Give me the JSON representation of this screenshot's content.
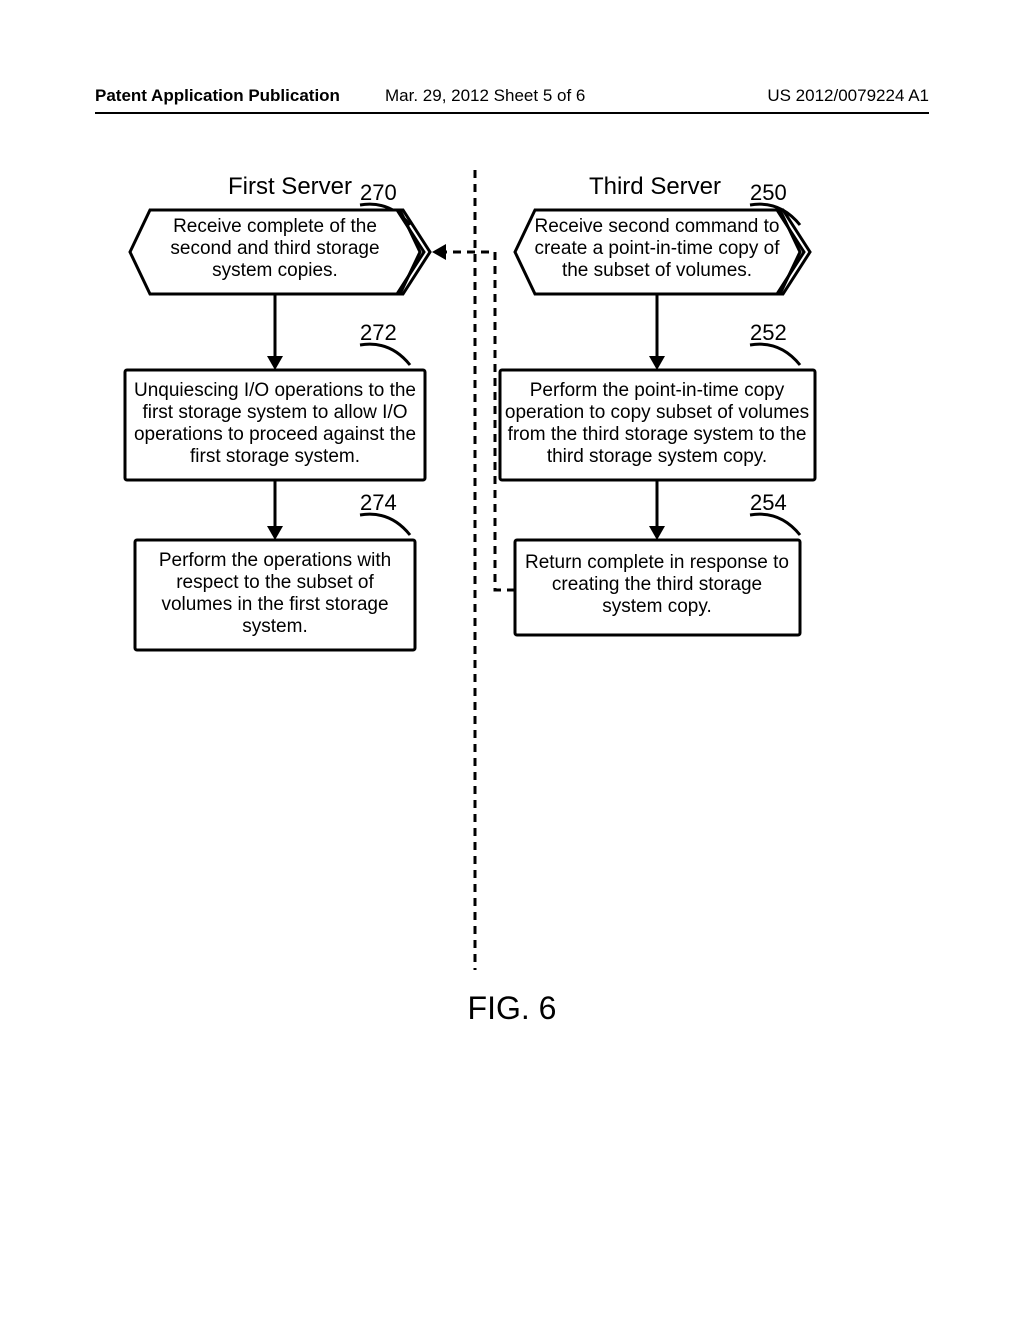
{
  "header": {
    "left": "Patent Application Publication",
    "mid": "Mar. 29, 2012  Sheet 5 of 6",
    "right": "US 2012/0079224 A1"
  },
  "titles": {
    "left": "First Server",
    "right": "Third Server"
  },
  "refs": {
    "r270": "270",
    "r272": "272",
    "r274": "274",
    "r250": "250",
    "r252": "252",
    "r254": "254"
  },
  "blocks": {
    "b270": [
      "Receive complete of the",
      "second and third storage",
      "system copies."
    ],
    "b272": [
      "Unquiescing I/O operations to the",
      "first storage system to allow I/O",
      "operations to proceed against the",
      "first storage system."
    ],
    "b274": [
      "Perform the operations with",
      "respect to the subset of",
      "volumes in the first storage",
      "system."
    ],
    "b250": [
      "Receive second command to",
      "create a point-in-time copy of",
      "the subset of volumes."
    ],
    "b252": [
      "Perform the point-in-time copy",
      "operation to copy subset of volumes",
      "from the third storage system to the",
      "third storage system copy."
    ],
    "b254": [
      "Return complete in response to",
      "creating the third storage",
      "system copy."
    ]
  },
  "figure_label": "FIG. 6",
  "chart_data": {
    "type": "flowchart",
    "swimlanes": [
      "First Server",
      "Third Server"
    ],
    "nodes": [
      {
        "id": "270",
        "lane": "First Server",
        "shape": "hexagon",
        "text": "Receive complete of the second and third storage system copies."
      },
      {
        "id": "272",
        "lane": "First Server",
        "shape": "rect",
        "text": "Unquiescing I/O operations to the first storage system to allow I/O operations to proceed against the first storage system."
      },
      {
        "id": "274",
        "lane": "First Server",
        "shape": "rect",
        "text": "Perform the operations with respect to the subset of volumes in the first storage system."
      },
      {
        "id": "250",
        "lane": "Third Server",
        "shape": "hexagon",
        "text": "Receive second command to create a point-in-time copy of the subset of volumes."
      },
      {
        "id": "252",
        "lane": "Third Server",
        "shape": "rect",
        "text": "Perform the point-in-time copy operation to copy subset of volumes from the third storage system to the third storage system copy."
      },
      {
        "id": "254",
        "lane": "Third Server",
        "shape": "rect",
        "text": "Return complete in response to creating the third storage system copy."
      }
    ],
    "edges": [
      {
        "from": "270",
        "to": "272"
      },
      {
        "from": "272",
        "to": "274"
      },
      {
        "from": "250",
        "to": "252"
      },
      {
        "from": "252",
        "to": "254"
      },
      {
        "from": "254",
        "to": "270",
        "style": "dashed"
      }
    ]
  }
}
